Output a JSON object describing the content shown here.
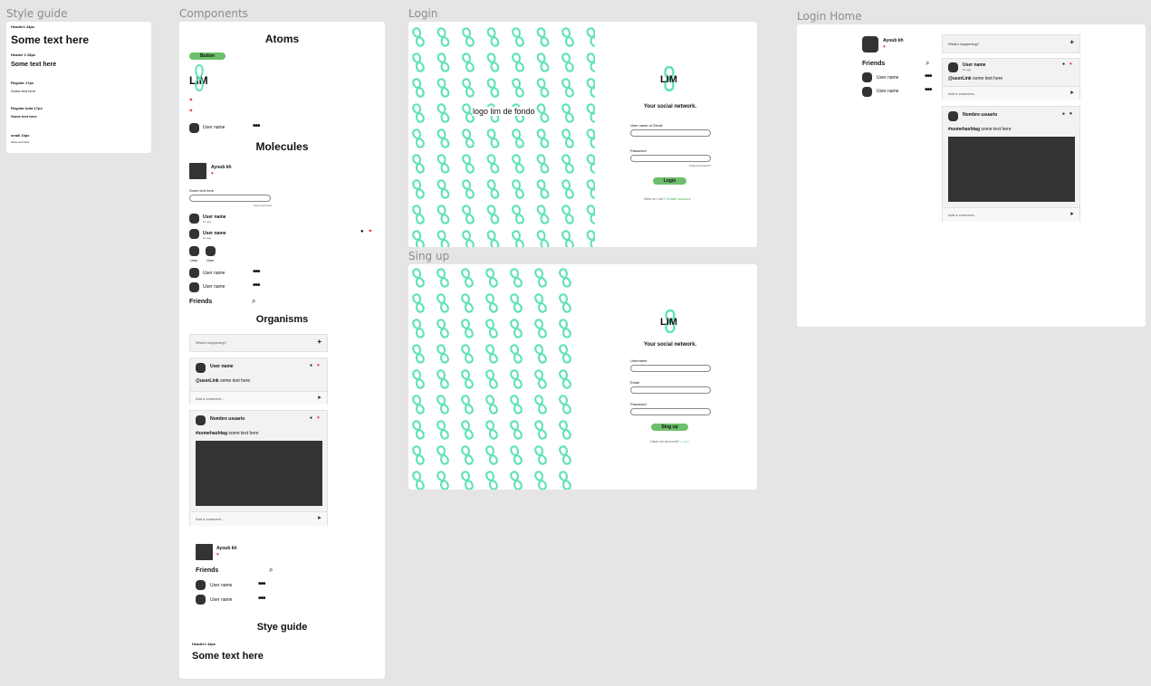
{
  "frames": {
    "style_guide": "Style guide",
    "components": "Components",
    "login": "Login",
    "signup": "Sing up",
    "login_home": "Login Home"
  },
  "style_guide": {
    "h1_label": "Header1  44px",
    "h1_text": "Some text here",
    "h2_label": "Header 2  28px",
    "h2_text": "Some text here",
    "regular_label": "Regular  17px",
    "regular_text": "Some text here",
    "regular_bold_label": "Regular bold  17px",
    "regular_bold_text": "Some text here",
    "small_label": "small  10px",
    "small_text": "Some text here"
  },
  "components": {
    "atoms_title": "Atoms",
    "button_label": "Button",
    "logo_text": "LIM",
    "user_name": "User name",
    "molecules_title": "Molecules",
    "profile_name": "Ayoub kh",
    "input_label": "Some text here",
    "input_hint": "Some text here",
    "user_time": "1h ago",
    "user_short": "User",
    "friends_label": "Friends",
    "organisms_title": "Organisms",
    "whats_happening": "What's happening?",
    "post1_author": "User name",
    "post1_text_tag": "@userLink",
    "post1_text": "some text here",
    "comment_placeholder": "Add a comment...",
    "post2_author": "Nombre usuario",
    "post2_text_tag": "#somehashtag",
    "post2_text": "some text here",
    "style_title": "Stye guide",
    "style_h1_label": "Header1  44px",
    "style_h1_text": "Some text here"
  },
  "login": {
    "bg_caption": "logo  lim de fondo",
    "logo_text": "LIM",
    "tagline": "Your social network.",
    "username_label": "User name or Email",
    "password_label": "Password",
    "forgot": "Forgot password?",
    "login_button": "Login",
    "new_text": "New on Lim?",
    "create_link": "Create account"
  },
  "signup": {
    "logo_text": "LIM",
    "tagline": "Your social network.",
    "username_label": "Username",
    "email_label": "Email",
    "password_label": "Password",
    "signup_button": "Sing up",
    "have_account": "Have an account?",
    "login_link": "Login"
  },
  "home": {
    "profile_name": "Ayoub kh",
    "friends_label": "Friends",
    "friend1": "User name",
    "friend2": "User name",
    "whats_happening": "What's happening?",
    "post1_author": "User name",
    "post1_time": "1h ago",
    "post1_text_tag": "@userLink",
    "post1_text": "some text here",
    "comment_placeholder": "Add a comment...",
    "post2_author": "Nombre usuario",
    "post2_text_tag": "#somehashtag",
    "post2_text": "some text here"
  },
  "colors": {
    "accent": "#6dbf6b",
    "pattern": "#5fe3b4",
    "dark": "#333333",
    "heart": "#e23b3b"
  }
}
